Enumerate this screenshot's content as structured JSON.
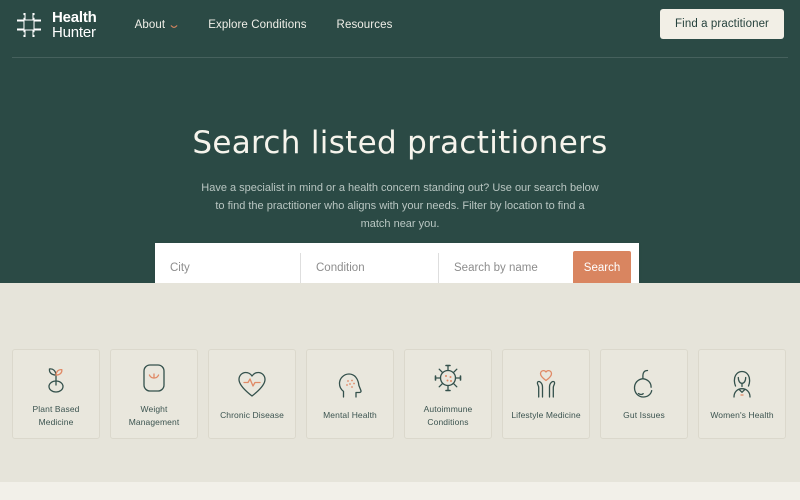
{
  "colors": {
    "hero_green": "#2b4a45",
    "page_beige": "#e6e4da",
    "accent_orange": "#d98560",
    "cream": "#f2f0e9",
    "card_bg": "#e9e7dd",
    "icon_stroke": "#34514c"
  },
  "header": {
    "logo": {
      "icon": "health-cross-grid-icon",
      "line1": "Health",
      "line2": "Hunter"
    },
    "nav": [
      {
        "label": "About",
        "has_dropdown": true,
        "icon": "chevron-down-icon"
      },
      {
        "label": "Explore Conditions",
        "has_dropdown": false
      },
      {
        "label": "Resources",
        "has_dropdown": false
      }
    ],
    "cta_label": "Find a practitioner"
  },
  "hero": {
    "title": "Search listed practitioners",
    "subtitle": "Have a specialist in mind or a health concern standing out? Use our search below to find the practitioner who aligns with your needs. Filter by location to find a match near you."
  },
  "search": {
    "city_placeholder": "City",
    "city_value": "",
    "condition_placeholder": "Condition",
    "condition_value": "",
    "name_placeholder": "Search by name",
    "name_value": "",
    "button_label": "Search"
  },
  "categories": [
    {
      "label": "Plant Based Medicine",
      "icon": "plant-seedling-icon"
    },
    {
      "label": "Weight Management",
      "icon": "weight-scale-icon"
    },
    {
      "label": "Chronic Disease",
      "icon": "heart-pulse-icon"
    },
    {
      "label": "Mental Health",
      "icon": "head-mind-icon"
    },
    {
      "label": "Autoimmune Conditions",
      "icon": "virus-cell-icon"
    },
    {
      "label": "Lifestyle Medicine",
      "icon": "hands-heart-icon"
    },
    {
      "label": "Gut Issues",
      "icon": "stomach-icon"
    },
    {
      "label": "Women's Health",
      "icon": "woman-figure-icon"
    }
  ]
}
